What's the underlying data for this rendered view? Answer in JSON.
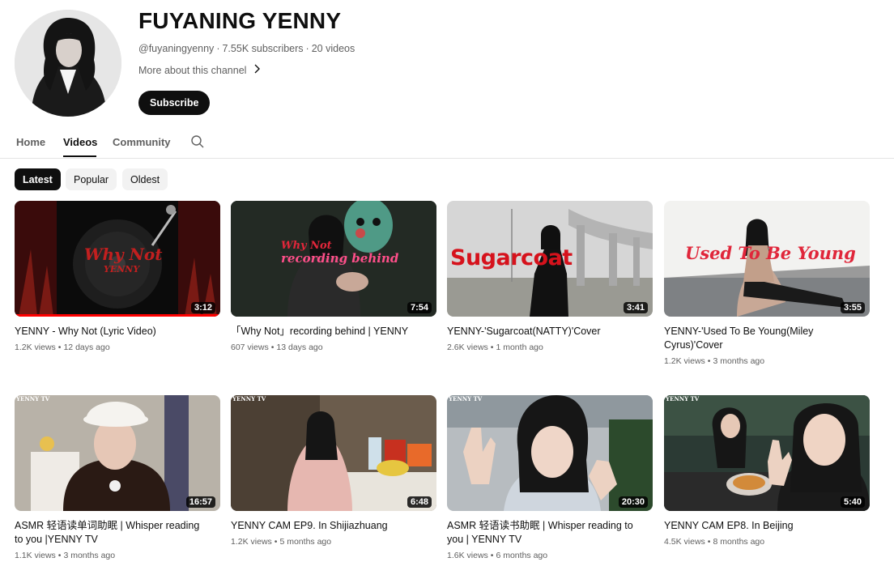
{
  "channel": {
    "name": "FUYANING YENNY",
    "handle": "@fuyaningyenny",
    "subscribers": "7.55K subscribers",
    "videos": "20 videos",
    "more_about": "More about this channel",
    "subscribe_label": "Subscribe"
  },
  "tabs": [
    {
      "label": "Home"
    },
    {
      "label": "Videos"
    },
    {
      "label": "Community"
    }
  ],
  "active_tab": "Videos",
  "chips": [
    {
      "label": "Latest"
    },
    {
      "label": "Popular"
    },
    {
      "label": "Oldest"
    }
  ],
  "active_chip": "Latest",
  "videos": [
    {
      "title": "YENNY - Why Not (Lyric Video)",
      "views": "1.2K views",
      "age": "12 days ago",
      "duration": "3:12",
      "thumb_text": "Why Not",
      "thumb_subtext": "YENNY",
      "watched_fraction": 1.0
    },
    {
      "title": "「Why Not」recording behind | YENNY",
      "views": "607 views",
      "age": "13 days ago",
      "duration": "7:54",
      "thumb_text": "recording behind",
      "thumb_subtext": "Why Not"
    },
    {
      "title": "YENNY-'Sugarcoat(NATTY)'Cover",
      "views": "2.6K views",
      "age": "1 month ago",
      "duration": "3:41",
      "thumb_text": "Sugarcoat"
    },
    {
      "title": "YENNY-'Used To Be Young(Miley Cyrus)'Cover",
      "views": "1.2K views",
      "age": "3 months ago",
      "duration": "3:55",
      "thumb_text": "Used To Be Young"
    },
    {
      "title": "ASMR 轻语读单词助眠 | Whisper reading to you |YENNY TV",
      "views": "1.1K views",
      "age": "3 months ago",
      "duration": "16:57",
      "thumb_text": "YENNY TV"
    },
    {
      "title": "YENNY CAM EP9. In Shijiazhuang",
      "views": "1.2K views",
      "age": "5 months ago",
      "duration": "6:48",
      "thumb_text": "YENNY TV"
    },
    {
      "title": "ASMR 轻语读书助眠 | Whisper reading to you | YENNY TV",
      "views": "1.6K views",
      "age": "6 months ago",
      "duration": "20:30",
      "thumb_text": "YENNY TV"
    },
    {
      "title": "YENNY CAM EP8. In Beijing",
      "views": "4.5K views",
      "age": "8 months ago",
      "duration": "5:40",
      "thumb_text": "YENNY TV"
    }
  ],
  "colors": {
    "primary_text": "#0f0f0f",
    "secondary_text": "#606060",
    "subscribe_bg": "#0f0f0f",
    "chip_bg": "#f2f2f2",
    "progress_red": "#ff0000"
  },
  "icons": {
    "search": "search-icon",
    "chevron": "chevron-right-icon"
  }
}
